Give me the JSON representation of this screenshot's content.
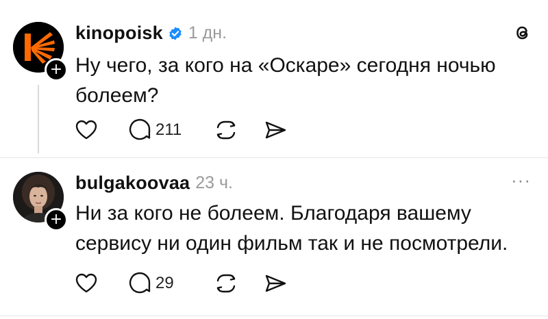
{
  "posts": [
    {
      "username": "kinopoisk",
      "time": "1 дн.",
      "text": "Ну чего, за кого на «Оскаре» сегодня ночью болеем?",
      "comments": "211",
      "verified": true,
      "icons": [
        "kinopoisk-logo",
        "verified-icon",
        "threads-logo-icon",
        "heart-icon",
        "comment-icon",
        "repost-icon",
        "share-icon"
      ]
    },
    {
      "username": "bulgakoovaa",
      "time": "23 ч.",
      "text": "Ни за кого не болеем. Благодаря вашему сервису ни один фильм так и не посмотрели.",
      "comments": "29",
      "more": "···",
      "icons": [
        "avatar-photo",
        "heart-icon",
        "comment-icon",
        "repost-icon",
        "share-icon"
      ]
    }
  ],
  "follow_symbol": "+",
  "colors": {
    "kinopoisk_orange": "#ff6a00",
    "verified_blue": "#1a8cff",
    "secondary_text": "#9a9a9a"
  }
}
